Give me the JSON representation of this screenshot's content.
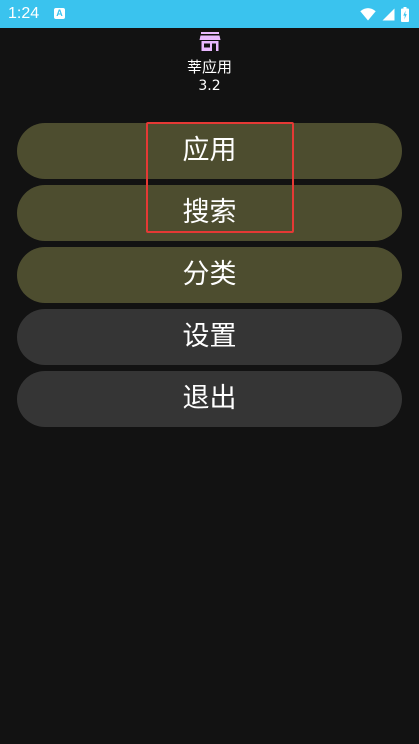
{
  "status_bar": {
    "time": "1:24",
    "notification_icon_letter": "A",
    "icons": [
      "wifi-icon",
      "signal-icon",
      "battery-icon"
    ],
    "background_color": "#3ac3ee"
  },
  "header": {
    "icon": "store-icon",
    "icon_color": "#e8b8ff",
    "app_name": "莘应用",
    "version": "3.2"
  },
  "menu": {
    "items": [
      {
        "label": "应用",
        "style": "olive"
      },
      {
        "label": "搜索",
        "style": "olive"
      },
      {
        "label": "分类",
        "style": "olive"
      },
      {
        "label": "设置",
        "style": "gray"
      },
      {
        "label": "退出",
        "style": "gray"
      }
    ]
  },
  "colors": {
    "background": "#121212",
    "button_olive": "#4d4d2f",
    "button_gray": "#353535",
    "highlight": "#e53935"
  }
}
